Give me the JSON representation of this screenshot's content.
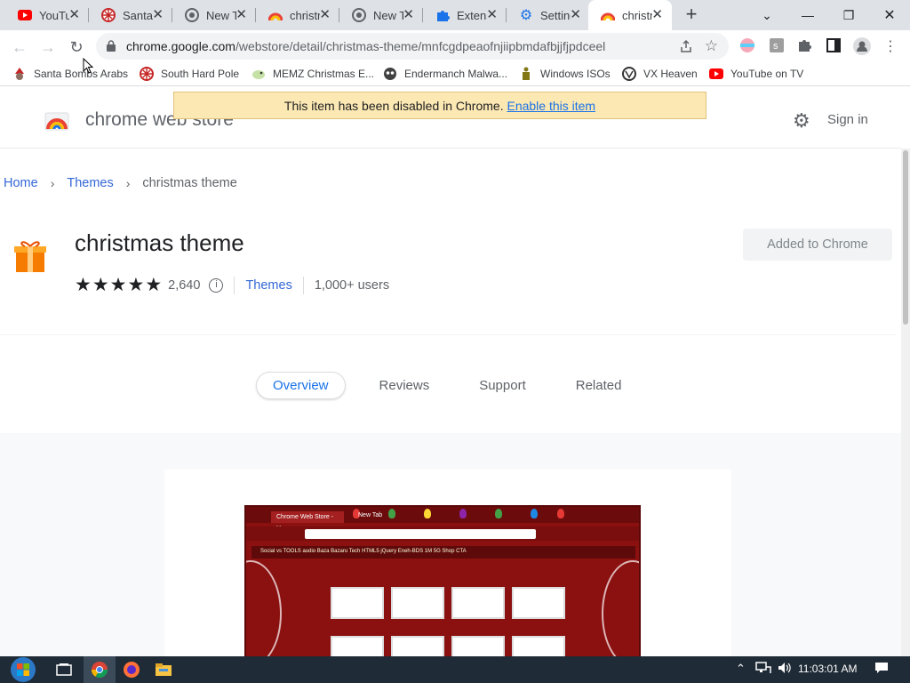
{
  "tabs": [
    {
      "label": "YouTube",
      "icon": "youtube-icon"
    },
    {
      "label": "Santa",
      "icon": "snowflake-icon"
    },
    {
      "label": "New Tab",
      "icon": "chrome-icon"
    },
    {
      "label": "christmas theme",
      "icon": "webstore-icon"
    },
    {
      "label": "New Tab",
      "icon": "chrome-icon"
    },
    {
      "label": "Extensions",
      "icon": "puzzle-icon"
    },
    {
      "label": "Settings",
      "icon": "gear-icon"
    },
    {
      "label": "christmas theme",
      "icon": "webstore-icon"
    }
  ],
  "window": {
    "minimize": "—",
    "maximize": "❐",
    "close": "✕",
    "tab_search": "⌄"
  },
  "toolbar": {
    "url_host": "chrome.google.com",
    "url_path": "/webstore/detail/christmas-theme/mnfcgdpeaofnjiipbmdafbjjfjpdceel"
  },
  "bookmarks": [
    {
      "label": "Santa Bombs Arabs",
      "icon": "santa-icon"
    },
    {
      "label": "South Hard Pole",
      "icon": "snowflake-icon"
    },
    {
      "label": "MEMZ Christmas E...",
      "icon": "bird-icon"
    },
    {
      "label": "Endermanch Malwa...",
      "icon": "face-icon"
    },
    {
      "label": "Windows ISOs",
      "icon": "figure-icon"
    },
    {
      "label": "VX Heaven",
      "icon": "vx-icon"
    },
    {
      "label": "YouTube on TV",
      "icon": "youtube-icon"
    }
  ],
  "banner": {
    "text": "This item has been disabled in Chrome.",
    "link": "Enable this item"
  },
  "store": {
    "title": "chrome web store",
    "sign_in": "Sign in"
  },
  "breadcrumb": {
    "home": "Home",
    "themes": "Themes",
    "current": "christmas theme"
  },
  "item": {
    "title": "christmas theme",
    "rating_count": "2,640",
    "rating": 4.5,
    "category": "Themes",
    "users": "1,000+ users",
    "added_label": "Added to Chrome"
  },
  "page_tabs": [
    "Overview",
    "Reviews",
    "Support",
    "Related"
  ],
  "screenshot": {
    "tab_label": "Chrome Web Store - Hom",
    "tab2_label": "New Tab",
    "bookmarks_text": "Social   vs   TOOLS   audio   Baza Bazaru Tech   HTML5   jQuery   Eneh-BDS   1M   5G   Shop CTA"
  },
  "taskbar": {
    "time": "11:03:01 AM"
  },
  "colors": {
    "accent": "#1a73e8",
    "link": "#3367d6",
    "banner": "#fce8b2",
    "taskbar": "#1f2b36"
  }
}
